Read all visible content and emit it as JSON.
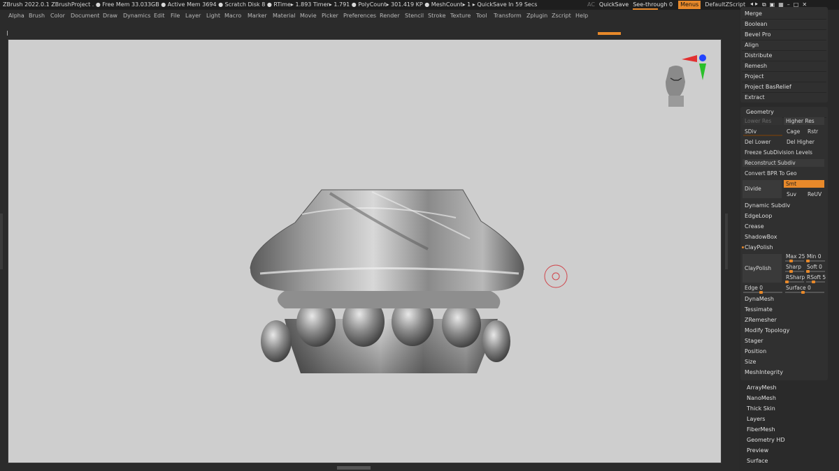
{
  "titlebar": {
    "text": "ZBrush 2022.0.1   ZBrushProject   . ● Free Mem 33.033GB ● Active Mem 3694 ● Scratch Disk 8 ●   RTime▸ 1.893 Timer▸ 1.791 ● PolyCount▸ 301.419 KP  ● MeshCount▸ 1   ▸ QuickSave In 59 Secs",
    "ac": "AC",
    "quicksave": "QuickSave",
    "see_through_label": "See-through",
    "see_through_value": "0",
    "menus": "Menus",
    "script": "DefaultZScript"
  },
  "menu": [
    "Alpha",
    "Brush",
    "Color",
    "Document",
    "Draw",
    "Dynamics",
    "Edit",
    "File",
    "Layer",
    "Light",
    "Macro",
    "Marker",
    "Material",
    "Movie",
    "Picker",
    "Preferences",
    "Render",
    "Stencil",
    "Stroke",
    "Texture",
    "Tool",
    "Transform",
    "Zplugin",
    "Zscript",
    "Help"
  ],
  "panel_top": [
    "Merge",
    "Boolean",
    "Bevel Pro",
    "Align",
    "Distribute",
    "Remesh",
    "Project",
    "Project BasRelief",
    "Extract"
  ],
  "geometry": {
    "title": "Geometry",
    "lower_res": "Lower Res",
    "higher_res": "Higher Res",
    "sdiv": "SDiv",
    "cage": "Cage",
    "rstr": "Rstr",
    "del_lower": "Del Lower",
    "del_higher": "Del Higher",
    "freeze": "Freeze SubDivision Levels",
    "reconstruct": "Reconstruct Subdiv",
    "convert_bpr": "Convert BPR To Geo",
    "divide": "Divide",
    "smt": "Smt",
    "suv": "Suv",
    "reuv": "ReUV",
    "dynamic_subdiv": "Dynamic Subdiv",
    "edgeloop": "EdgeLoop",
    "crease": "Crease",
    "shadowbox": "ShadowBox",
    "claypolish_header": "ClayPolish",
    "claypolish_btn": "ClayPolish",
    "max": "Max 25",
    "min": "Min 0",
    "sharp": "Sharp",
    "soft": "Soft 0",
    "rsharp": "RSharp",
    "rsoft": "RSoft 5",
    "edge": "Edge 0",
    "surface": "Surface 0",
    "rest": [
      "DynaMesh",
      "Tessimate",
      "ZRemesher",
      "Modify Topology",
      "Stager",
      "Position",
      "Size",
      "MeshIntegrity"
    ]
  },
  "panel_bottom": [
    "ArrayMesh",
    "NanoMesh",
    "Thick Skin",
    "Layers",
    "FiberMesh",
    "Geometry HD",
    "Preview",
    "Surface"
  ],
  "colors": {
    "accent": "#e8892a",
    "viewport": "#cecece",
    "ui_bg": "#2b2b2b"
  },
  "icons": {
    "gizmo": "head-orientation-gizmo-icon",
    "cursor": "brush-cursor-icon"
  }
}
